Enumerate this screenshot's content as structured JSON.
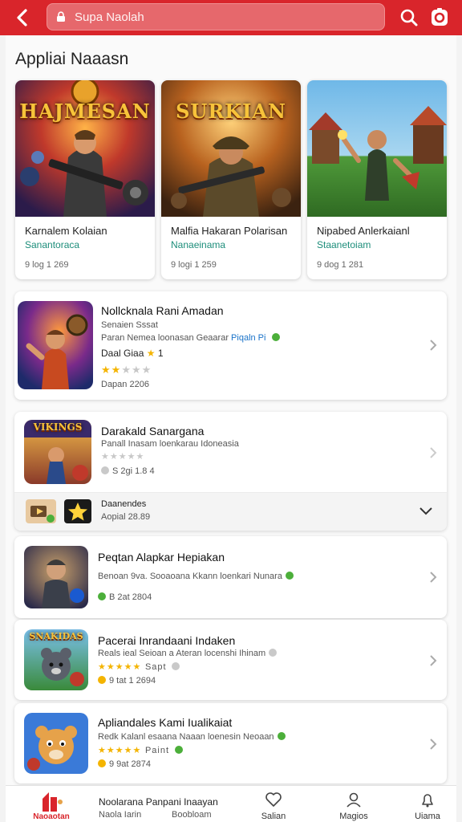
{
  "header": {
    "search_text": "Supa Naolah",
    "colors": {
      "bar": "#d9252b",
      "accent_teal": "#1c8d7a",
      "link": "#1a73c9",
      "star": "#f4b400",
      "verified": "#4caf3a"
    },
    "icons": [
      "back-arrow-icon",
      "lock-icon",
      "search-icon",
      "record-icon"
    ]
  },
  "section": {
    "title": "Appliai Naaasn"
  },
  "featured": [
    {
      "art_title": "HAJMESAN",
      "name": "Karnalem Kolaian",
      "subtitle": "Sanantoraca",
      "size": "9 log 1 269"
    },
    {
      "art_title": "SURKIAN",
      "name": "Malfia Hakaran Polarisan",
      "subtitle": "Nanaeinama",
      "size": "9 logi 1 259"
    },
    {
      "art_title": "",
      "name": "Nipabed Anlerkaianl",
      "subtitle": "Staanetoiam",
      "size": "9 dog 1 281"
    }
  ],
  "list1": {
    "title": "Nollcknala Rani Amadan",
    "line1": "Senaien Sssat",
    "line2": "Paran Nemea loonasan Geaarar",
    "link": "Piqaln Pi",
    "line3": "Daal Giaa",
    "rating_value": "1",
    "rating_stars": 2,
    "date": "Dapan 2206"
  },
  "list2": {
    "title": "Darakald Sanargana",
    "line1": "Panall Inasam loenkarau Idoneasia",
    "rating_stars": 0,
    "date": "S 2gi 1.8 4",
    "sub_title": "Daanendes",
    "sub_date": "Aopial 28.89",
    "art_title": "VIKINGS"
  },
  "list3": {
    "title": "Peqtan Alapkar Hepiakan",
    "line1": "Benoan 9va. Sooaoana Kkann loenkari Nunara",
    "date": "B 2at 2804"
  },
  "list4": {
    "title": "Pacerai Inrandaani Indaken",
    "line1": "Reals ieal Seioan a Ateran locenshi Ihinam",
    "rating_stars": 5,
    "rating_text": "Sapt",
    "date": "9 tat 1 2694",
    "art_title": "SNAKIDAS"
  },
  "list5": {
    "title": "Apliandales Kami Iualikaiat",
    "line1": "Redk Kalanl esaana Naaan loenesin Neoaan",
    "rating_stars": 5,
    "rating_text": "Paint",
    "date": "9 9at 2874"
  },
  "bottom_nav": [
    {
      "label": "Noolarana Panpani Inaayan",
      "sub": "Naola Iarin",
      "icon": "app-logo-icon",
      "logo_text": "Naoaotan"
    },
    {
      "label": "Boobloam",
      "icon": ""
    },
    {
      "label": "Salian",
      "icon": "heart-icon"
    },
    {
      "label": "Magios",
      "icon": "person-icon"
    },
    {
      "label": "Uiama",
      "icon": "bell-icon"
    }
  ]
}
